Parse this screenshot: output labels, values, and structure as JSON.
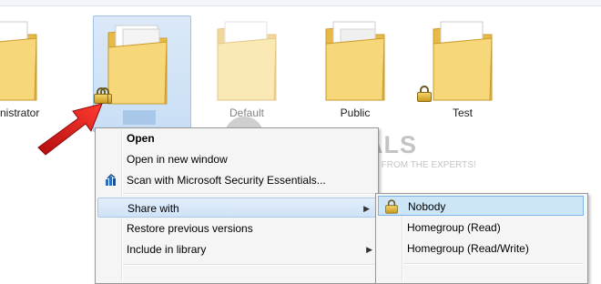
{
  "folders": [
    {
      "name": "Administrator",
      "locked": true
    },
    {
      "name": "",
      "locked": true,
      "selected": true
    },
    {
      "name": "Default",
      "locked": false
    },
    {
      "name": "Public",
      "locked": false
    },
    {
      "name": "Test",
      "locked": true
    }
  ],
  "context_menu": {
    "items": [
      {
        "label": "Open",
        "bold": true
      },
      {
        "label": "Open in new window"
      },
      {
        "label": "Scan with Microsoft Security Essentials...",
        "icon": "security-essentials-icon"
      },
      {
        "label": "Share with",
        "submenu": true,
        "highlighted": true
      },
      {
        "label": "Restore previous versions"
      },
      {
        "label": "Include in library",
        "submenu": true
      }
    ]
  },
  "share_submenu": {
    "items": [
      {
        "label": "Nobody",
        "icon": "lock-icon",
        "highlighted": true
      },
      {
        "label": "Homegroup (Read)"
      },
      {
        "label": "Homegroup (Read/Write)"
      }
    ]
  },
  "watermark": {
    "brand": "APPUALS",
    "tagline": "TECH HOW-TO'S FROM THE EXPERTS!"
  },
  "colors": {
    "accent_arrow": "#e0201b",
    "folder": "#f2cf6b"
  }
}
